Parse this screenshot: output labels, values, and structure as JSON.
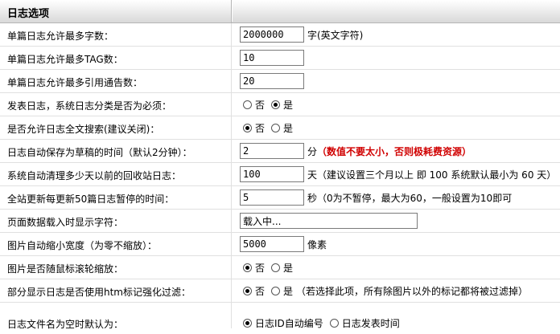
{
  "header": {
    "title": "日志选项"
  },
  "rows": [
    {
      "label": "单篇日志允许最多字数：",
      "value": "2000000",
      "note": "字(英文字符)"
    },
    {
      "label": "单篇日志允许最多TAG数：",
      "value": "10"
    },
    {
      "label": "单篇日志允许最多引用通告数：",
      "value": "20"
    },
    {
      "label": "发表日志，系统日志分类是否为必须：",
      "options": [
        "否",
        "是"
      ],
      "selected": "是"
    },
    {
      "label": "是否允许日志全文搜索(建议关闭)：",
      "options": [
        "否",
        "是"
      ],
      "selected": "否"
    },
    {
      "label": "日志自动保存为草稿的时间（默认2分钟）：",
      "value": "2",
      "unit": "分",
      "note": "（数值不要太小，否则极耗费资源）"
    },
    {
      "label": "系统自动清理多少天以前的回收站日志：",
      "value": "100",
      "unit": "天",
      "note": "（建议设置三个月以上 即 100 系统默认最小为 60 天）"
    },
    {
      "label": "全站更新每更新50篇日志暂停的时间：",
      "value": "5",
      "unit": "秒",
      "note": "（0为不暂停，最大为60，一般设置为10即可"
    },
    {
      "label": "页面数据载入时显示字符：",
      "value": "载入中..."
    },
    {
      "label": "图片自动缩小宽度（为零不缩放）：",
      "value": "5000",
      "note": "像素"
    },
    {
      "label": "图片是否随鼠标滚轮缩放：",
      "options": [
        "否",
        "是"
      ],
      "selected": "否"
    },
    {
      "label": "部分显示日志是否使用htm标记强化过滤：",
      "options": [
        "否",
        "是"
      ],
      "selected": "否",
      "note": "（若选择此项，所有除图片以外的标记都将被过滤掉）"
    },
    {
      "label": "日志文件名为空时默认为：",
      "options": [
        "日志ID自动编号",
        "日志发表时间"
      ],
      "selected": "日志ID自动编号"
    }
  ]
}
